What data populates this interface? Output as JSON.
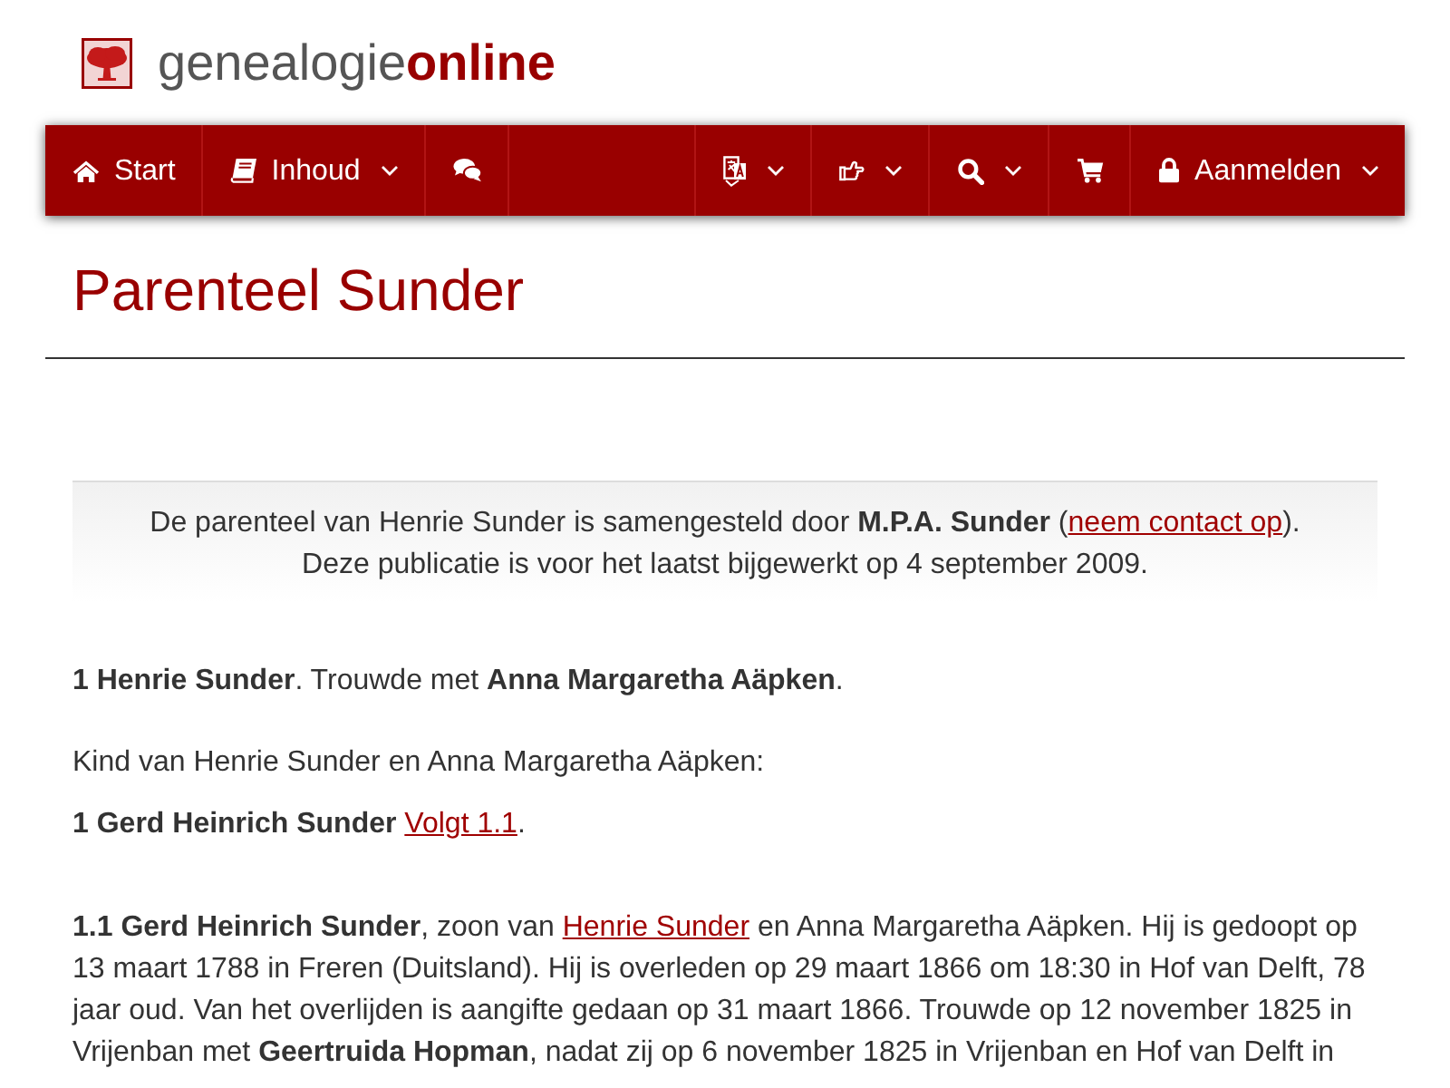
{
  "header": {
    "site_name": "genealogie**online**"
  },
  "nav": {
    "left": [
      {
        "label": "Start",
        "dropdown": false
      },
      {
        "label": "Inhoud",
        "dropdown": true
      },
      {
        "dropdown": false
      }
    ],
    "right": [
      {
        "dropdown": true
      },
      {
        "dropdown": true
      },
      {
        "dropdown": true
      },
      {
        "dropdown": false
      },
      {
        "label": "Aanmelden",
        "dropdown": true
      }
    ]
  },
  "title": "Parenteel Sunder",
  "notice": {
    "lines": [
      [
        {
          "kind": "text",
          "text": "De parenteel van Henrie Sunder is samengesteld door **M.P.A. Sunder** ("
        },
        {
          "kind": "link",
          "text": "neem contact op"
        },
        {
          "kind": "text",
          "text": ")."
        }
      ],
      [
        {
          "kind": "text",
          "text": "Deze publicatie is voor het laatst bijgewerkt op 4 september 2009."
        }
      ]
    ]
  },
  "entries": [
    {
      "kind": "person",
      "parts": [
        {
          "kind": "text",
          "text": "**1 Henrie Sunder**. Trouwde met **Anna Margaretha Aäpken**."
        }
      ]
    },
    {
      "kind": "children_heading",
      "parts": [
        {
          "kind": "text",
          "text": "Kind van Henrie Sunder en Anna Margaretha Aäpken:"
        }
      ]
    },
    {
      "kind": "child",
      "parts": [
        {
          "kind": "text",
          "text": "**1 Gerd Heinrich Sunder** "
        },
        {
          "kind": "link",
          "text": "Volgt 1.1"
        },
        {
          "kind": "text",
          "text": "."
        }
      ]
    },
    {
      "kind": "details",
      "parts": [
        {
          "kind": "text",
          "text": "**1.1 Gerd Heinrich Sunder**, zoon van "
        },
        {
          "kind": "link",
          "text": "Henrie Sunder"
        },
        {
          "kind": "text",
          "text": " en Anna Margaretha Aäpken. Hij is gedoopt op 13 maart 1788 in Freren (Duitsland). Hij is overleden op 29 maart 1866 om 18:30 in Hof van Delft, 78 jaar oud. Van het overlijden is aangifte gedaan op 31 maart 1866. Trouwde op 12 november 1825 in Vrijenban met **Geertruida Hopman**, nadat zij op 6 november 1825 in Vrijenban en Hof van Delft in"
        }
      ]
    }
  ]
}
